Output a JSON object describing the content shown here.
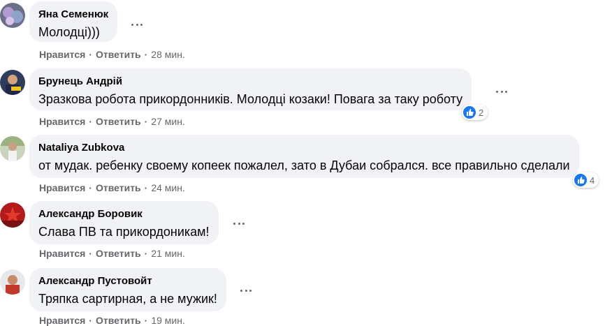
{
  "actions": {
    "like": "Нравится",
    "reply": "Ответить",
    "dot": "·"
  },
  "colors": {
    "accent": "#1877f2",
    "bubble": "#f0f2f5",
    "meta": "#65676b"
  },
  "comments": [
    {
      "author": "Яна Семенюк",
      "text": "Молодці)))",
      "time": "28 мин."
    },
    {
      "author": "Брунець Андрій",
      "text": "Зразкова робота прикордонників. Молодці козаки! Повага за таку роботу",
      "time": "27 мин.",
      "reactions": "2",
      "reaction_icon": "like-icon"
    },
    {
      "author": "Nataliya Zubkova",
      "text": "от мудак. ребенку своему копеек пожалел, зато в Дубаи собрался. все правильно сделали",
      "time": "24 мин.",
      "reactions": "4",
      "reaction_icon": "like-icon"
    },
    {
      "author": "Александр Боровик",
      "text": "Слава ПВ та прикордоникам!",
      "time": "21 мин."
    },
    {
      "author": "Александр Пустовойт",
      "text": "Тряпка сартирная, а не мужик!",
      "time": "19 мин."
    }
  ]
}
